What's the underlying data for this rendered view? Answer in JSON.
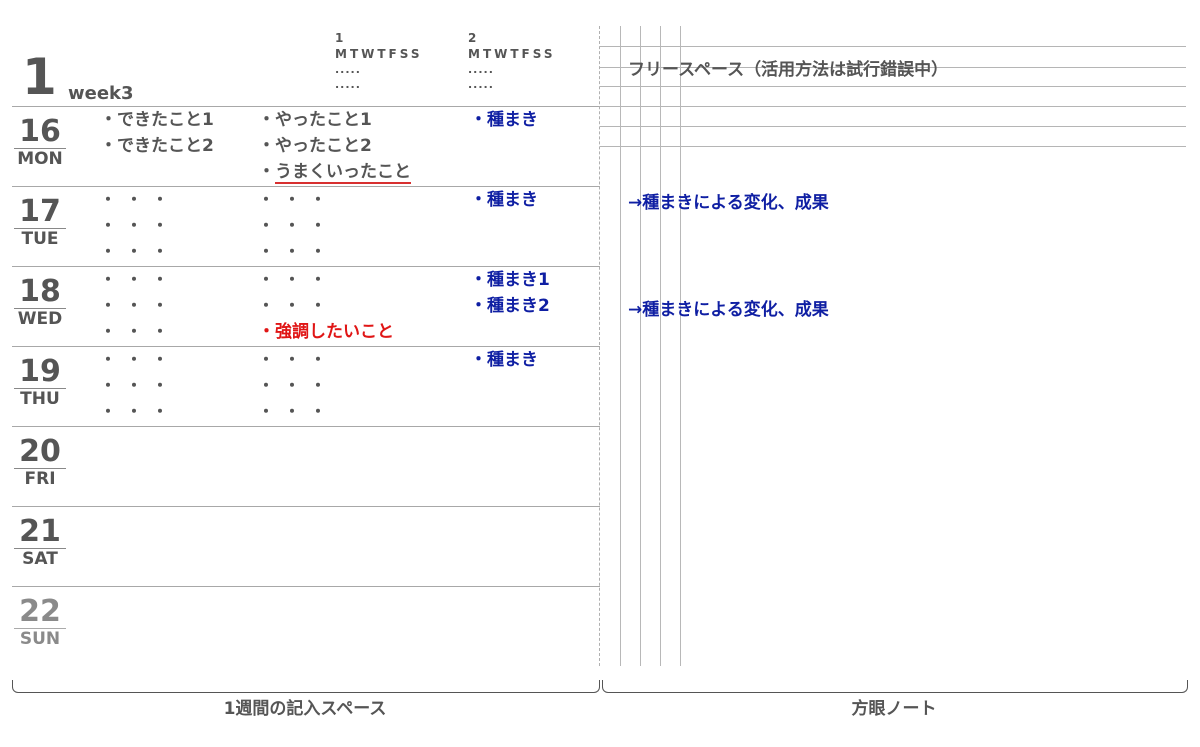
{
  "header": {
    "month": "1",
    "week": "week3",
    "habit1": {
      "index": "1",
      "days": "MTWTFSS",
      "row1": ".....",
      "row2": "....."
    },
    "habit2": {
      "index": "2",
      "days": "MTWTFSS",
      "row1": ".....",
      "row2": "....."
    }
  },
  "days": [
    {
      "num": "16",
      "dow": "MON"
    },
    {
      "num": "17",
      "dow": "TUE"
    },
    {
      "num": "18",
      "dow": "WED"
    },
    {
      "num": "19",
      "dow": "THU"
    },
    {
      "num": "20",
      "dow": "FRI"
    },
    {
      "num": "21",
      "dow": "SAT"
    },
    {
      "num": "22",
      "dow": "SUN"
    }
  ],
  "entries": {
    "done1": "・できたこと1",
    "done2": "・できたこと2",
    "did1": "・やったこと1",
    "did2": "・やったこと2",
    "bullet": "・",
    "went_well": "うまくいったこと",
    "emphasis": "・強調したいこと",
    "seed": "・種まき",
    "seed1": "・種まき1",
    "seed2": "・種まき2",
    "ellipsis": "・・・"
  },
  "right": {
    "title": "フリースペース（活用方法は試行錯誤中）",
    "note1": "→種まきによる変化、成果",
    "note2": "→種まきによる変化、成果"
  },
  "footer": {
    "left_label": "1週間の記入スペース",
    "right_label": "方眼ノート"
  },
  "colors": {
    "text": "#555555",
    "blue": "#0f1fa3",
    "red": "#e01515",
    "rule": "#a8a8a8"
  }
}
